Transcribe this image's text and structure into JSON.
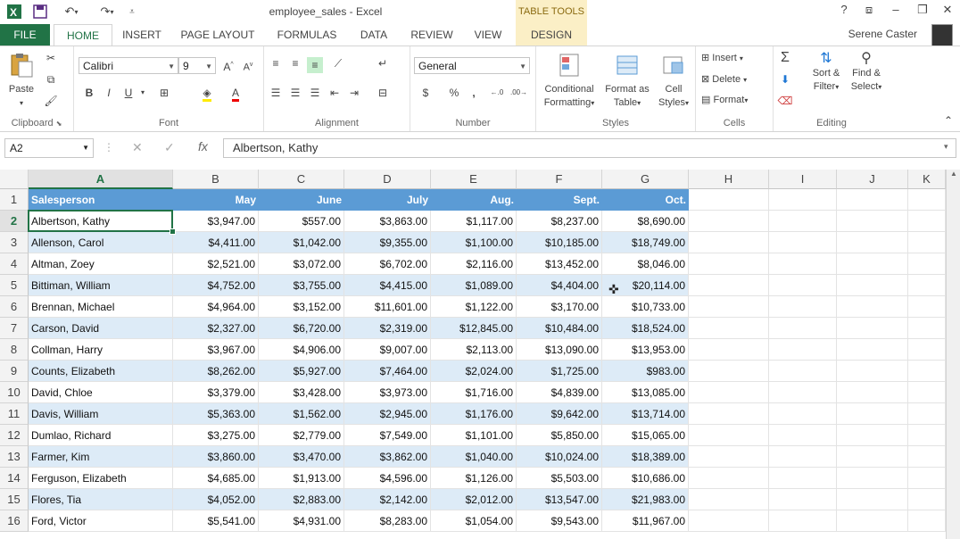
{
  "title_bar": {
    "title": "employee_sales - Excel",
    "table_tools": "TABLE TOOLS",
    "help": "?",
    "user": "Serene Caster"
  },
  "tabs": [
    {
      "label": "FILE"
    },
    {
      "label": "HOME"
    },
    {
      "label": "INSERT"
    },
    {
      "label": "PAGE LAYOUT"
    },
    {
      "label": "FORMULAS"
    },
    {
      "label": "DATA"
    },
    {
      "label": "REVIEW"
    },
    {
      "label": "VIEW"
    },
    {
      "label": "DESIGN"
    }
  ],
  "ribbon": {
    "clipboard": {
      "label": "Clipboard",
      "paste": "Paste"
    },
    "font": {
      "label": "Font",
      "name": "Calibri",
      "size": "9",
      "bold": "B",
      "italic": "I",
      "underline": "U"
    },
    "alignment": {
      "label": "Alignment"
    },
    "number": {
      "label": "Number",
      "format": "General",
      "currency": "$",
      "percent": "%",
      "comma": ","
    },
    "styles": {
      "label": "Styles",
      "conditional_1": "Conditional",
      "conditional_2": "Formatting",
      "format_table_1": "Format as",
      "format_table_2": "Table",
      "cell_styles_1": "Cell",
      "cell_styles_2": "Styles"
    },
    "cells": {
      "label": "Cells",
      "insert": "Insert",
      "delete": "Delete",
      "format": "Format"
    },
    "editing": {
      "label": "Editing",
      "sort_1": "Sort &",
      "sort_2": "Filter",
      "find_1": "Find &",
      "find_2": "Select"
    }
  },
  "formula_bar": {
    "name_box": "A2",
    "formula": "Albertson, Kathy"
  },
  "columns": [
    "A",
    "B",
    "C",
    "D",
    "E",
    "F",
    "G",
    "H",
    "I",
    "J",
    "K"
  ],
  "row_numbers": [
    "1",
    "2",
    "3",
    "4",
    "5",
    "6",
    "7",
    "8",
    "9",
    "10",
    "11",
    "12",
    "13",
    "14",
    "15",
    "16"
  ],
  "table": {
    "headers": [
      "Salesperson",
      "May",
      "June",
      "July",
      "Aug.",
      "Sept.",
      "Oct."
    ],
    "rows": [
      [
        "Albertson, Kathy",
        "$3,947.00",
        "$557.00",
        "$3,863.00",
        "$1,117.00",
        "$8,237.00",
        "$8,690.00"
      ],
      [
        "Allenson, Carol",
        "$4,411.00",
        "$1,042.00",
        "$9,355.00",
        "$1,100.00",
        "$10,185.00",
        "$18,749.00"
      ],
      [
        "Altman, Zoey",
        "$2,521.00",
        "$3,072.00",
        "$6,702.00",
        "$2,116.00",
        "$13,452.00",
        "$8,046.00"
      ],
      [
        "Bittiman, William",
        "$4,752.00",
        "$3,755.00",
        "$4,415.00",
        "$1,089.00",
        "$4,404.00",
        "$20,114.00"
      ],
      [
        "Brennan, Michael",
        "$4,964.00",
        "$3,152.00",
        "$11,601.00",
        "$1,122.00",
        "$3,170.00",
        "$10,733.00"
      ],
      [
        "Carson, David",
        "$2,327.00",
        "$6,720.00",
        "$2,319.00",
        "$12,845.00",
        "$10,484.00",
        "$18,524.00"
      ],
      [
        "Collman, Harry",
        "$3,967.00",
        "$4,906.00",
        "$9,007.00",
        "$2,113.00",
        "$13,090.00",
        "$13,953.00"
      ],
      [
        "Counts, Elizabeth",
        "$8,262.00",
        "$5,927.00",
        "$7,464.00",
        "$2,024.00",
        "$1,725.00",
        "$983.00"
      ],
      [
        "David, Chloe",
        "$3,379.00",
        "$3,428.00",
        "$3,973.00",
        "$1,716.00",
        "$4,839.00",
        "$13,085.00"
      ],
      [
        "Davis, William",
        "$5,363.00",
        "$1,562.00",
        "$2,945.00",
        "$1,176.00",
        "$9,642.00",
        "$13,714.00"
      ],
      [
        "Dumlao, Richard",
        "$3,275.00",
        "$2,779.00",
        "$7,549.00",
        "$1,101.00",
        "$5,850.00",
        "$15,065.00"
      ],
      [
        "Farmer, Kim",
        "$3,860.00",
        "$3,470.00",
        "$3,862.00",
        "$1,040.00",
        "$10,024.00",
        "$18,389.00"
      ],
      [
        "Ferguson, Elizabeth",
        "$4,685.00",
        "$1,913.00",
        "$4,596.00",
        "$1,126.00",
        "$5,503.00",
        "$10,686.00"
      ],
      [
        "Flores, Tia",
        "$4,052.00",
        "$2,883.00",
        "$2,142.00",
        "$2,012.00",
        "$13,547.00",
        "$21,983.00"
      ],
      [
        "Ford, Victor",
        "$5,541.00",
        "$4,931.00",
        "$8,283.00",
        "$1,054.00",
        "$9,543.00",
        "$11,967.00"
      ]
    ]
  },
  "colors": {
    "excel_green": "#217346",
    "table_header": "#5b9bd5",
    "table_band": "#ddebf7",
    "table_tools_bg": "#fbefc6"
  }
}
